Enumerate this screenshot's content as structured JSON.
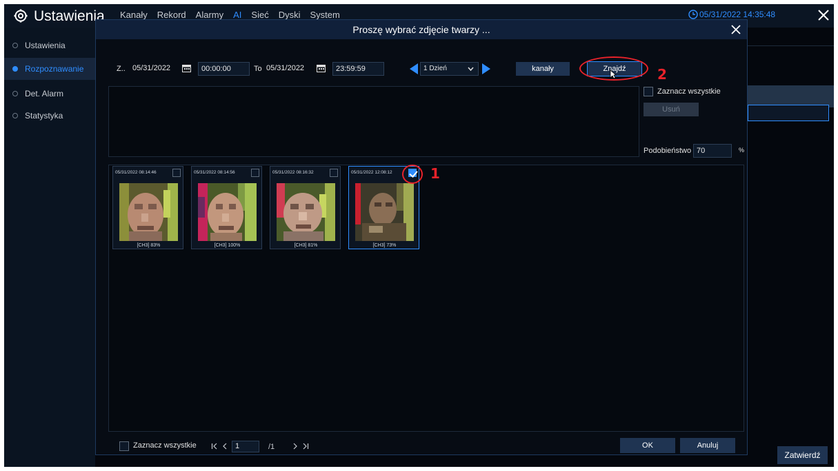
{
  "app": {
    "title": "Ustawienia",
    "menu": [
      "Kanały",
      "Rekord",
      "Alarmy",
      "AI",
      "Sieć",
      "Dyski",
      "System"
    ],
    "active_menu": "AI",
    "datetime": "05/31/2022 14:35:48"
  },
  "sidebar": {
    "items": [
      {
        "label": "Ustawienia",
        "active": false
      },
      {
        "label": "Rozpoznawanie",
        "active": true
      },
      {
        "label": "Det. Alarm",
        "active": false
      },
      {
        "label": "Statystyka",
        "active": false
      }
    ]
  },
  "modal": {
    "title": "Proszę wybrać zdjęcie twarzy ...",
    "from_label": "Z..",
    "from_date": "05/31/2022",
    "from_time": "00:00:00",
    "to_label": "To",
    "to_date": "05/31/2022",
    "to_time": "23:59:59",
    "range_value": "1 Dzień",
    "channels_button": "kanały",
    "search_button": "Znajdź",
    "select_all_top": "Zaznacz wszystkie",
    "delete_button": "Usuń",
    "similarity_label": "Podobieństwo",
    "similarity_value": "70",
    "similarity_unit": "%",
    "results": [
      {
        "time": "05/31/2022 08:14:46",
        "caption": "[CH3] 83%",
        "checked": false
      },
      {
        "time": "05/31/2022 08:14:56",
        "caption": "[CH3] 100%",
        "checked": false
      },
      {
        "time": "05/31/2022 08:16:32",
        "caption": "[CH3] 81%",
        "checked": false
      },
      {
        "time": "05/31/2022 12:08:12",
        "caption": "[CH3] 73%",
        "checked": true
      }
    ],
    "select_all_bottom": "Zaznacz wszystkie",
    "page_current": "1",
    "page_total": "/1",
    "ok_button": "OK",
    "cancel_button": "Anuluj"
  },
  "footer": {
    "confirm_button": "Zatwierdź"
  },
  "annotations": {
    "label_1": "1",
    "label_2": "2",
    "color": "#e8222a"
  },
  "colors": {
    "accent": "#2f8dff",
    "background": "#04070d",
    "panel": "#10203a"
  }
}
